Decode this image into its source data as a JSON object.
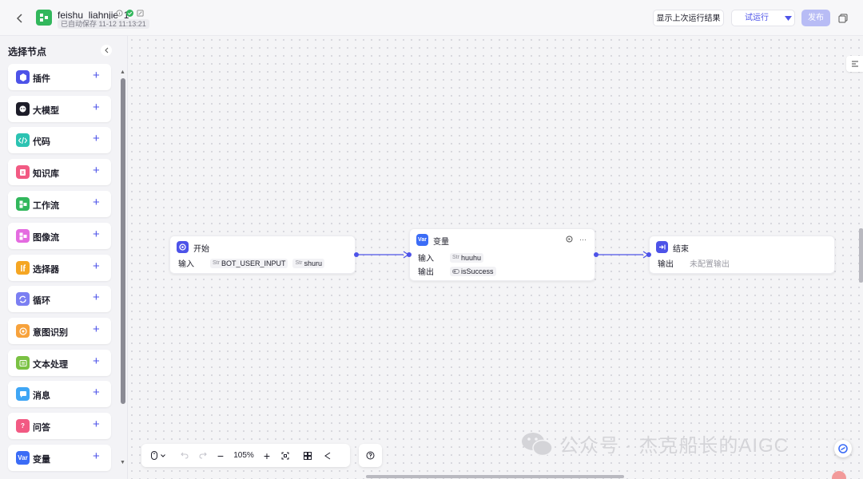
{
  "header": {
    "title": "feishu_liahnjie_1",
    "autosave": "已自动保存 11-12 11:13:21",
    "show_last_run": "显示上次运行结果",
    "test_run": "试运行",
    "publish": "发布"
  },
  "sidebar": {
    "title": "选择节点",
    "items": [
      {
        "label": "插件",
        "color": "#4d53e8",
        "icon": "plugin-icon"
      },
      {
        "label": "大模型",
        "color": "#1d1d29",
        "icon": "llm-icon"
      },
      {
        "label": "代码",
        "color": "#2cc3b2",
        "icon": "code-icon"
      },
      {
        "label": "知识库",
        "color": "#f25a83",
        "icon": "knowledge-icon"
      },
      {
        "label": "工作流",
        "color": "#32b75c",
        "icon": "workflow-icon"
      },
      {
        "label": "图像流",
        "color": "#e46be0",
        "icon": "imageflow-icon"
      },
      {
        "label": "选择器",
        "color": "#f5a623",
        "icon": "condition-icon"
      },
      {
        "label": "循环",
        "color": "#7b7ff2",
        "icon": "loop-icon"
      },
      {
        "label": "意图识别",
        "color": "#f7a23c",
        "icon": "intent-icon"
      },
      {
        "label": "文本处理",
        "color": "#7ac143",
        "icon": "text-icon"
      },
      {
        "label": "消息",
        "color": "#3fa6f5",
        "icon": "message-icon"
      },
      {
        "label": "问答",
        "color": "#f25a83",
        "icon": "qa-icon"
      },
      {
        "label": "变量",
        "color": "#3b6cf6",
        "icon": "variable-icon"
      }
    ]
  },
  "nodes": {
    "start": {
      "title": "开始",
      "input_label": "输入",
      "params": [
        {
          "type": "Str",
          "name": "BOT_USER_INPUT"
        },
        {
          "type": "Str",
          "name": "shuru"
        }
      ]
    },
    "variable": {
      "title": "变量",
      "icon_text": "Var",
      "input_label": "输入",
      "input_param": {
        "type": "Str",
        "name": "huuhu"
      },
      "output_label": "输出",
      "output_param": "isSuccess"
    },
    "end": {
      "title": "结束",
      "output_label": "输出",
      "output_value": "未配置输出"
    }
  },
  "toolbar": {
    "zoom": "105%"
  },
  "watermark": "公众号 · 杰克船长的AIGC",
  "colors": {
    "accent": "#4d53e8",
    "success": "#32b75c"
  }
}
